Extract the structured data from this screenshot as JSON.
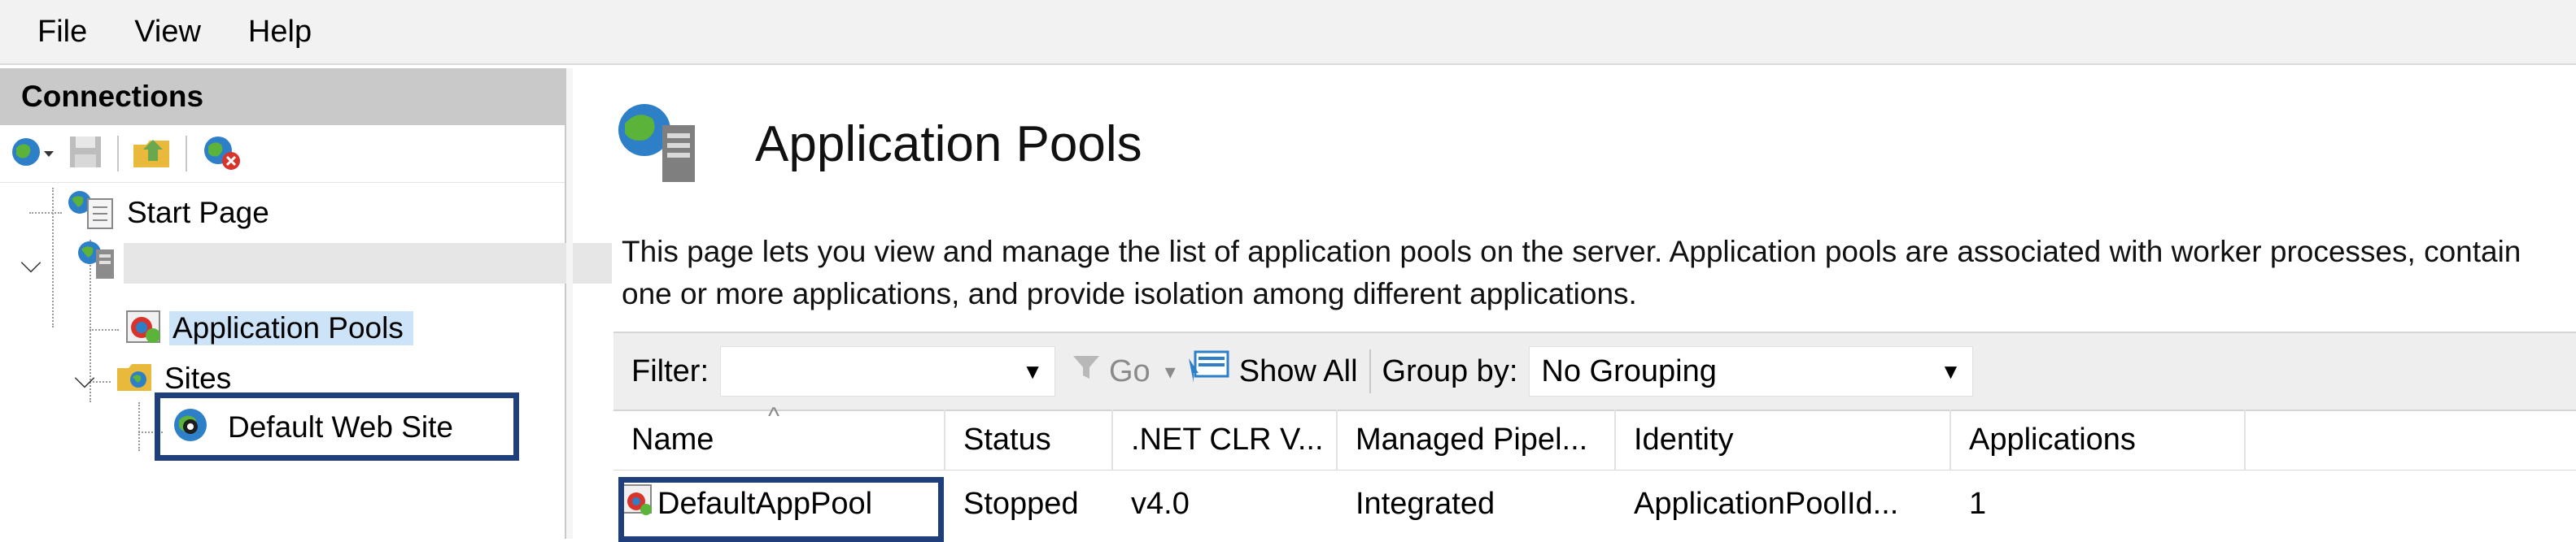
{
  "menu": [
    "File",
    "View",
    "Help"
  ],
  "connections": {
    "header": "Connections",
    "tree": {
      "start_page": "Start Page",
      "server": "",
      "application_pools": "Application Pools",
      "sites": "Sites",
      "default_web_site": "Default Web Site"
    }
  },
  "main": {
    "title": "Application Pools",
    "description": "This page lets you view and manage the list of application pools on the server. Application pools are associated with worker processes, contain one or more applications, and provide isolation among different applications.",
    "filterbar": {
      "filter_label": "Filter:",
      "filter_value": "",
      "go_label": "Go",
      "show_all_label": "Show All",
      "group_by_label": "Group by:",
      "group_by_value": "No Grouping"
    },
    "columns": [
      "Name",
      "Status",
      ".NET CLR V...",
      "Managed Pipel...",
      "Identity",
      "Applications"
    ],
    "rows": [
      {
        "name": "DefaultAppPool",
        "status": "Stopped",
        "clr": "v4.0",
        "pipeline": "Integrated",
        "identity": "ApplicationPoolId...",
        "applications": "1"
      }
    ]
  },
  "colors": {
    "selection": "#cde3f7",
    "highlight_border": "#1f3f7a",
    "header_gray": "#c9c9c9"
  }
}
